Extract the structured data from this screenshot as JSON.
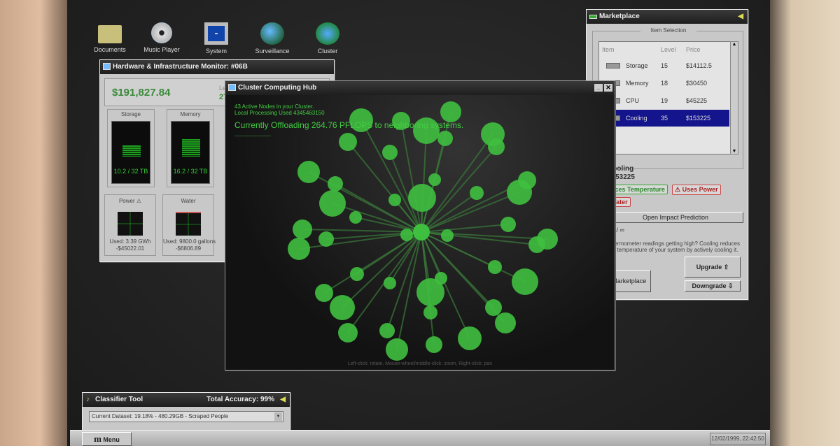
{
  "desktop": {
    "icons": [
      {
        "label": "Documents",
        "icon": "folder-icon"
      },
      {
        "label": "Music Player",
        "icon": "cd-icon"
      },
      {
        "label": "System",
        "icon": "computer-icon"
      },
      {
        "label": "Surveillance",
        "icon": "globe-search-icon"
      },
      {
        "label": "Cluster",
        "icon": "network-icon"
      }
    ]
  },
  "hardware": {
    "title": "Hardware & Infrastructure Monitor: #06B",
    "balance": "$191,827.84",
    "level_label": "Le",
    "level_value": "27",
    "storage": {
      "label": "Storage",
      "value": "10.2 / 32 TB",
      "fill": 0.32
    },
    "memory": {
      "label": "Memory",
      "value": "16.2 / 32 TB",
      "fill": 0.5
    },
    "power": {
      "label": "Power ⚠",
      "used": "Used: 3.39 GWh",
      "cost": "-$45022.01"
    },
    "water": {
      "label": "Water",
      "used": "Used: 9800.0 gallons",
      "cost": "-$6806.89"
    }
  },
  "cluster": {
    "title": "Cluster Computing Hub",
    "nodes_text": "43 Active Nodes in your Cluster.",
    "local_text": "Local Processing Used 4345463150",
    "offload_text": "Currently Offloading 264.76 PFLOPS to neighboring systems.",
    "dashes": "--------------------------",
    "help": "Left-click: rotate, Mouse-wheel/middle-click: zoom, Right-click: pan",
    "active_nodes": 43,
    "node_color": "#3fbf3f"
  },
  "market": {
    "title": "Marketplace",
    "section": "Item Selection",
    "columns": [
      "Item",
      "Level",
      "Price"
    ],
    "items": [
      {
        "name": "Storage",
        "level": "15",
        "price": "$14112.5"
      },
      {
        "name": "Memory",
        "level": "18",
        "price": "$30450"
      },
      {
        "name": "CPU",
        "level": "19",
        "price": "$45225"
      },
      {
        "name": "Cooling",
        "level": "35",
        "price": "$153225",
        "selected": true
      }
    ],
    "selected_name": "Cooling",
    "selected_price": "$153225",
    "tag_good": "Reduces Temperature",
    "tag_power": "⚠ Uses Power",
    "tag_water": "Water",
    "impact_button": "Open Impact Prediction",
    "count": "35 / ∞",
    "description": "Thermometer readings getting high? Cooling reduces the temperature of your system by actively cooling it.",
    "upgrade": "Upgrade ⇧",
    "downgrade": "Downgrade ⇩",
    "close_button": "Close Marketplace",
    "selection_color": "#14148c"
  },
  "classifier": {
    "title": "Classifier Tool",
    "accuracy": "Total Accuracy: 99%",
    "dataset": "Current Dataset: 19.18% - 480.29GB - Scraped People"
  },
  "taskbar": {
    "menu": "Menu",
    "clock": "12/02/1999, 22:42:50"
  }
}
